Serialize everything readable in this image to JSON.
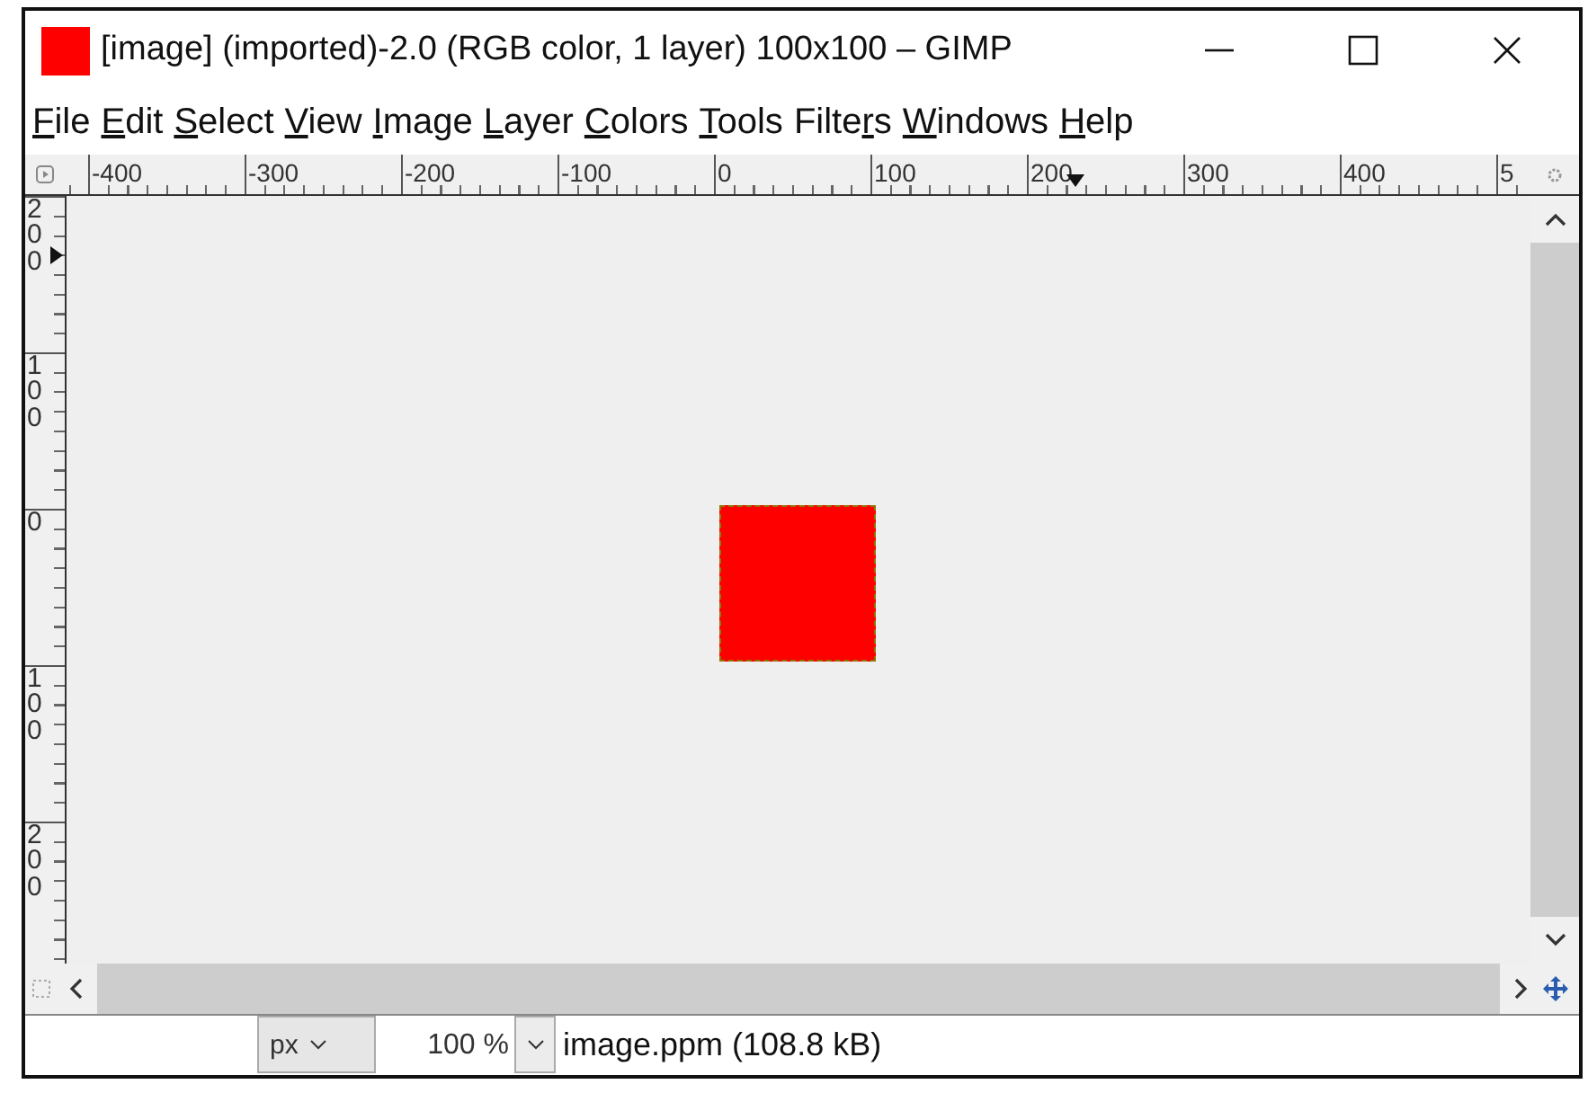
{
  "window": {
    "title": "[image] (imported)-2.0 (RGB color, 1 layer) 100x100 – GIMP"
  },
  "menu": [
    {
      "key": "F",
      "rest": "ile"
    },
    {
      "key": "E",
      "rest": "dit"
    },
    {
      "key": "S",
      "rest": "elect"
    },
    {
      "key": "V",
      "rest": "iew"
    },
    {
      "key": "I",
      "rest": "mage"
    },
    {
      "key": "L",
      "rest": "ayer"
    },
    {
      "key": "C",
      "rest": "olors"
    },
    {
      "key": "T",
      "rest": "ools"
    },
    {
      "pre": "Filte",
      "key": "r",
      "rest": "s"
    },
    {
      "key": "W",
      "rest": "indows"
    },
    {
      "key": "H",
      "rest": "elp"
    }
  ],
  "horizontal_ruler": [
    "-400",
    "-300",
    "-200",
    "-100",
    "0",
    "100",
    "200",
    "300",
    "400",
    "5"
  ],
  "vertical_ruler": [
    "200",
    "100",
    "0",
    "100",
    "200"
  ],
  "status_bar": {
    "unit": "px",
    "zoom": "100 %",
    "file_info": "image.ppm (108.8 kB)"
  }
}
